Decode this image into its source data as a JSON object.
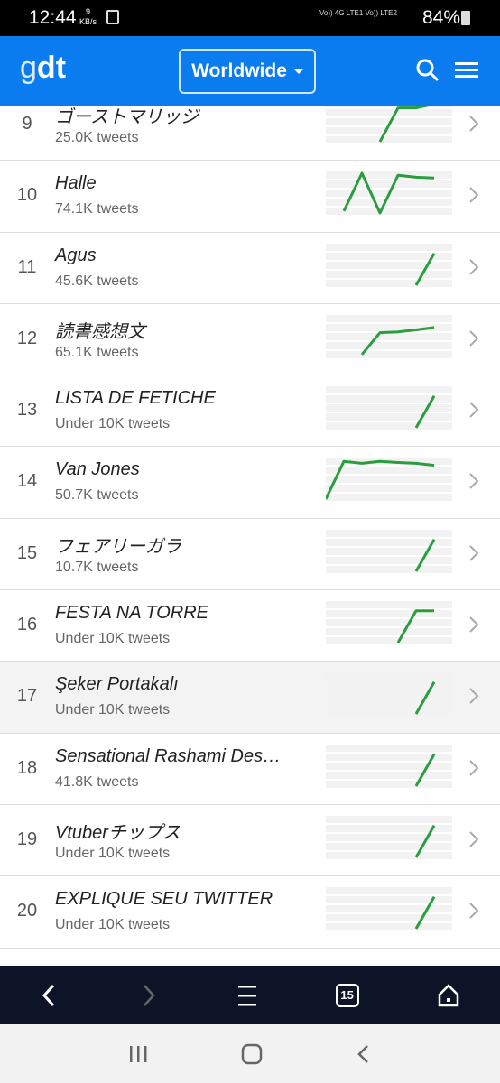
{
  "status": {
    "time": "12:44",
    "speed_value": "9",
    "speed_unit": "KB/s",
    "signal_text": "Vo)) 4G LTE1  Vo)) LTE2",
    "battery": "84%"
  },
  "header": {
    "logo_g": "g",
    "logo_dt": "dt",
    "location": "Worldwide",
    "icons": [
      "search-icon",
      "menu-icon"
    ]
  },
  "accent": "#0a7cf0",
  "spark_color": "#2a9d3f",
  "trends": [
    {
      "rank": "9",
      "name": "ゴーストマリッジ",
      "tweets": "25.0K tweets",
      "spark": [
        null,
        null,
        null,
        null,
        0,
        0.85,
        0.85,
        0.95
      ]
    },
    {
      "rank": "10",
      "name": "Halle",
      "tweets": "74.1K tweets",
      "spark": [
        null,
        null,
        0.05,
        1,
        0,
        0.95,
        0.9,
        0.88
      ]
    },
    {
      "rank": "11",
      "name": "Agus",
      "tweets": "45.6K tweets",
      "spark": [
        null,
        null,
        null,
        null,
        null,
        null,
        0,
        0.8
      ]
    },
    {
      "rank": "12",
      "name": "読書感想文",
      "tweets": "65.1K tweets",
      "spark": [
        null,
        null,
        null,
        0.05,
        0.6,
        0.62,
        0.67,
        0.73
      ]
    },
    {
      "rank": "13",
      "name": "LISTA DE FETICHE",
      "tweets": "Under 10K tweets",
      "spark": [
        null,
        null,
        null,
        null,
        null,
        null,
        0,
        0.8
      ]
    },
    {
      "rank": "14",
      "name": "Van Jones",
      "tweets": "50.7K tweets",
      "spark": [
        null,
        0,
        0.95,
        0.9,
        0.95,
        0.92,
        0.9,
        0.85
      ]
    },
    {
      "rank": "15",
      "name": "フェアリーガラ",
      "tweets": "10.7K tweets",
      "spark": [
        null,
        null,
        null,
        null,
        null,
        null,
        0,
        0.8
      ]
    },
    {
      "rank": "16",
      "name": "FESTA NA TORRE",
      "tweets": "Under 10K tweets",
      "spark": [
        null,
        null,
        null,
        null,
        null,
        0,
        0.8,
        0.8
      ]
    },
    {
      "rank": "17",
      "name": "Şeker Portakalı",
      "tweets": "Under 10K tweets",
      "spark": [
        null,
        null,
        null,
        null,
        null,
        null,
        0,
        0.8
      ],
      "highlighted": true
    },
    {
      "rank": "18",
      "name": "Sensational Rashami Des…",
      "tweets": "41.8K tweets",
      "spark": [
        null,
        null,
        null,
        null,
        null,
        null,
        0,
        0.8
      ]
    },
    {
      "rank": "19",
      "name": "Vtuberチップス",
      "tweets": "Under 10K tweets",
      "spark": [
        null,
        null,
        null,
        null,
        null,
        null,
        0,
        0.8
      ]
    },
    {
      "rank": "20",
      "name": "EXPLIQUE SEU TWITTER",
      "tweets": "Under 10K tweets",
      "spark": [
        null,
        null,
        null,
        null,
        null,
        null,
        0,
        0.8
      ]
    }
  ],
  "browser_bar": {
    "tabs_count": "15",
    "icons": [
      "back-icon",
      "forward-icon",
      "menu-icon",
      "tabs-icon",
      "home-icon"
    ]
  },
  "system_nav": {
    "icons": [
      "recents-icon",
      "home-icon",
      "back-icon"
    ]
  }
}
